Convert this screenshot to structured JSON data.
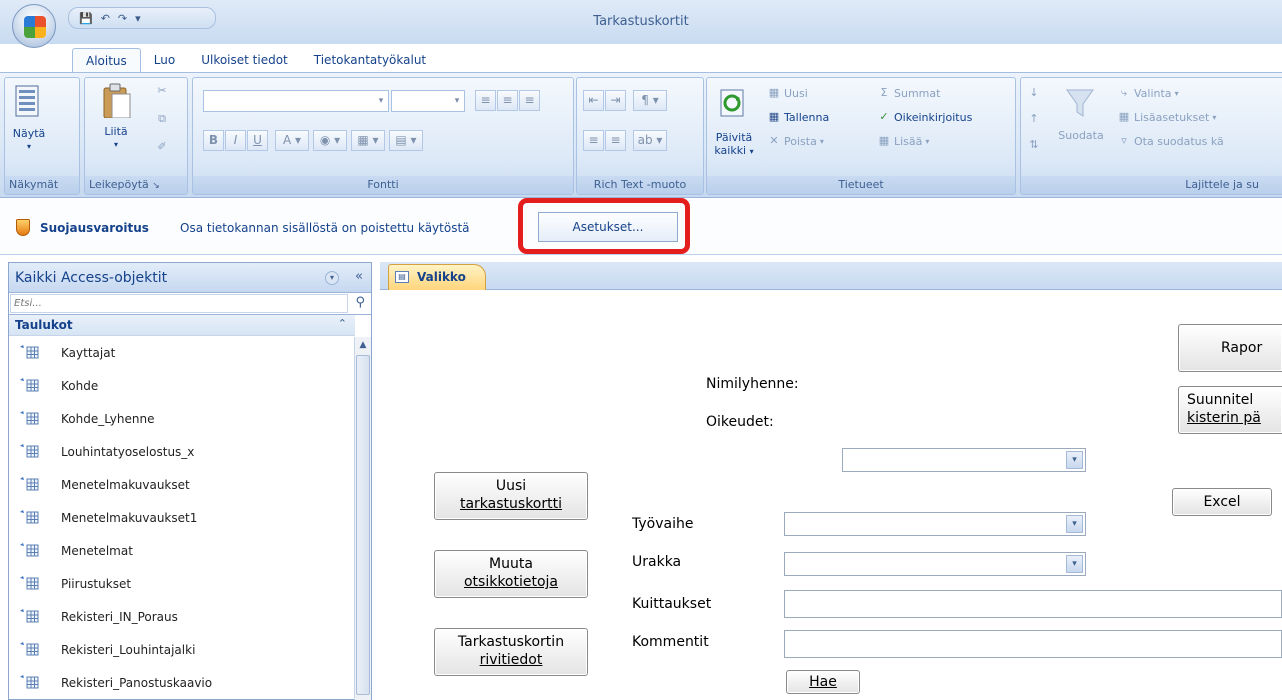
{
  "window": {
    "title": "Tarkastuskortit"
  },
  "ribbon": {
    "tabs": [
      "Aloitus",
      "Luo",
      "Ulkoiset tiedot",
      "Tietokantatyökalut"
    ],
    "groups": {
      "nakymat": {
        "label": "Näkymät",
        "view_label": "Näytä"
      },
      "leikepoyta": {
        "label": "Leikepöytä",
        "paste_label": "Liitä"
      },
      "fontti": {
        "label": "Fontti"
      },
      "richtext": {
        "label": "Rich Text -muoto"
      },
      "tietueet": {
        "label": "Tietueet",
        "refresh_label_1": "Päivitä",
        "refresh_label_2": "kaikki",
        "new": "Uusi",
        "save": "Tallenna",
        "delete": "Poista",
        "totals": "Summat",
        "spelling": "Oikeinkirjoitus",
        "more": "Lisää"
      },
      "lajittele": {
        "label": "Lajittele ja su",
        "filter": "Suodata",
        "selection": "Valinta",
        "advanced": "Lisäasetukset",
        "toggle_filter": "Ota suodatus kä"
      }
    }
  },
  "security_bar": {
    "title": "Suojausvaroitus",
    "message": "Osa tietokannan sisällöstä on poistettu käytöstä",
    "options_button": "Asetukset..."
  },
  "nav": {
    "title": "Kaikki Access-objektit",
    "search_placeholder": "Etsi...",
    "group": "Taulukot",
    "items": [
      "Kayttajat",
      "Kohde",
      "Kohde_Lyhenne",
      "Louhintatyoselostus_x",
      "Menetelmakuvaukset",
      "Menetelmakuvaukset1",
      "Menetelmat",
      "Piirustukset",
      "Rekisteri_IN_Poraus",
      "Rekisteri_Louhintajalki",
      "Rekisteri_Panostuskaavio"
    ]
  },
  "document": {
    "tab": "Valikko",
    "form": {
      "nimilyhenne_label": "Nimilyhenne:",
      "oikeudet_label": "Oikeudet:",
      "tyovaihe_label": "Työvaihe",
      "urakka_label": "Urakka",
      "kuittaukset_label": "Kuittaukset",
      "kommentit_label": "Kommentit",
      "btn_uusi_1": "Uusi",
      "btn_uusi_2": "tarkastuskortti",
      "btn_muuta_1": "Muuta",
      "btn_muuta_2": "otsikkotietoja",
      "btn_rivit_1": "Tarkastuskortin",
      "btn_rivit_2": "rivitiedot",
      "btn_hae": "Hae",
      "btn_excel": "Excel",
      "btn_raportit": "Rapor",
      "btn_suunnittelu_1": "Suunnitel",
      "btn_suunnittelu_2": "kisterin pä"
    }
  }
}
